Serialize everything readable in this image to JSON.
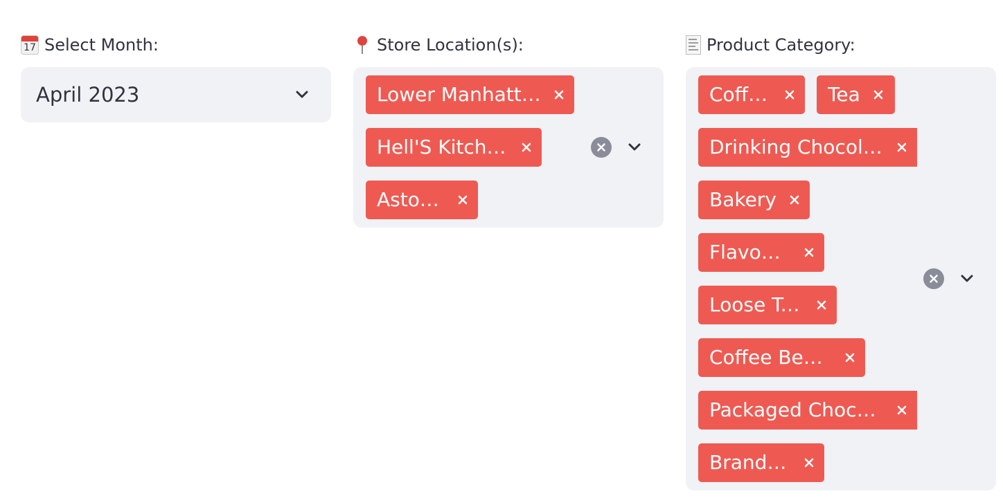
{
  "filters": {
    "month": {
      "icon": "calendar-icon",
      "icon_text": "17",
      "label": "Select Month:",
      "value": "April 2023"
    },
    "store": {
      "icon": "pushpin-icon",
      "label": "Store Location(s):",
      "chips": [
        "Lower Manhattan",
        "Hell'S Kitchen",
        "Astoria"
      ]
    },
    "category": {
      "icon": "receipt-icon",
      "label": "Product Category:",
      "chips": [
        "Coffee",
        "Tea",
        "Drinking Chocolate",
        "Bakery",
        "Flavours",
        "Loose Tea",
        "Coffee Beans",
        "Packaged Choco…",
        "Branded"
      ]
    }
  },
  "colors": {
    "chip_bg": "#ee5a52",
    "box_bg": "#f0f2f6",
    "text": "#31333f",
    "clear_icon_bg": "#8a8d99"
  }
}
